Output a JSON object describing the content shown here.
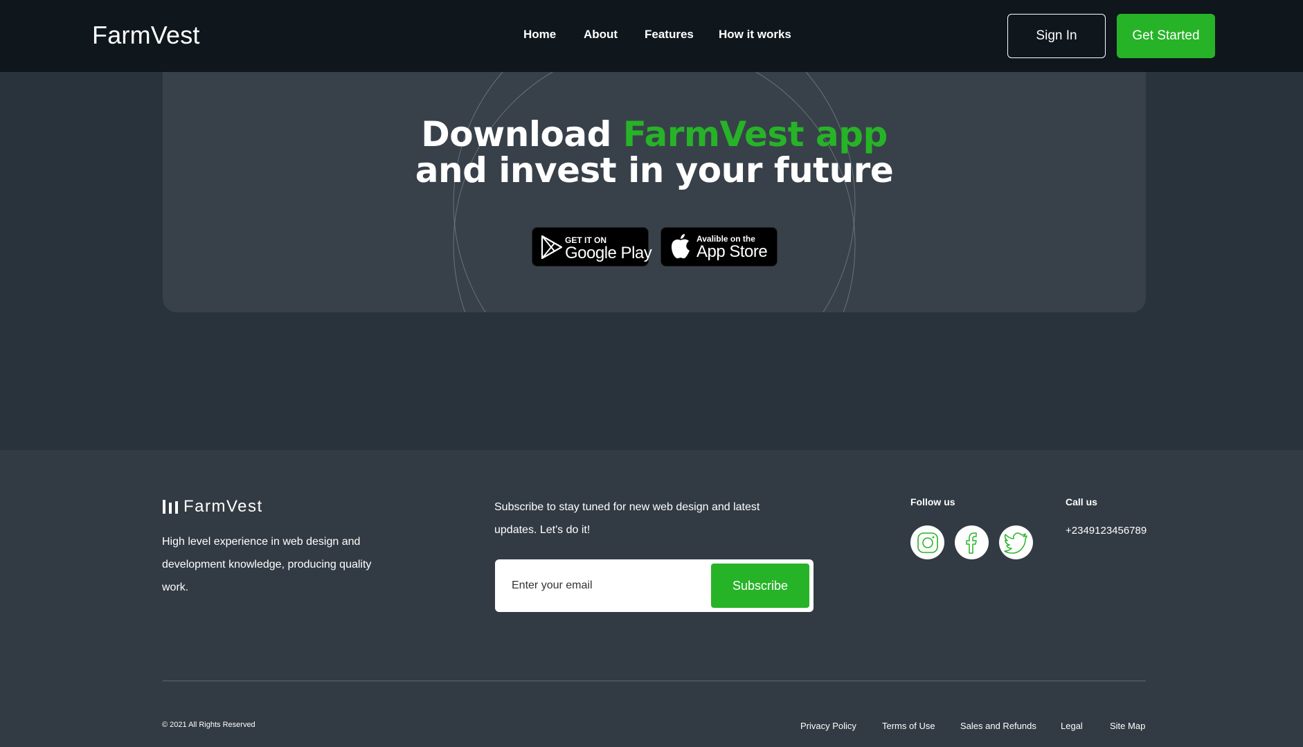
{
  "header": {
    "brand": "FarmVest",
    "nav": [
      "Home",
      "About",
      "Features",
      "How it works"
    ],
    "sign_in": "Sign In",
    "get_started": "Get Started"
  },
  "hero": {
    "line1_prefix": "Download ",
    "line1_highlight": "FarmVest app",
    "line2": "and invest in your future",
    "google_play": {
      "small": "GET IT ON",
      "big": "Google Play"
    },
    "app_store": {
      "small": "Avalible on the",
      "big": "App Store"
    }
  },
  "footer": {
    "brand": "FarmVest",
    "description": "High level experience in web design and development knowledge, producing quality work.",
    "subscribe_text": "Subscribe to stay tuned for new web design and latest updates. Let's do it!",
    "email_placeholder": "Enter your email",
    "subscribe_button": "Subscribe",
    "follow_heading": "Follow us",
    "call_heading": "Call us",
    "phone": "+2349123456789",
    "social_icons": [
      "instagram-icon",
      "facebook-icon",
      "twitter-icon"
    ],
    "copyright": "© 2021 All Rights Reserved",
    "links": [
      "Privacy Policy",
      "Terms of Use",
      "Sales and Refunds",
      "Legal",
      "Site Map"
    ]
  },
  "colors": {
    "accent": "#27b327",
    "header_bg": "#0f171d",
    "page_bg": "#28333b",
    "card_bg": "#38414a",
    "footer_bg": "#323b43"
  }
}
